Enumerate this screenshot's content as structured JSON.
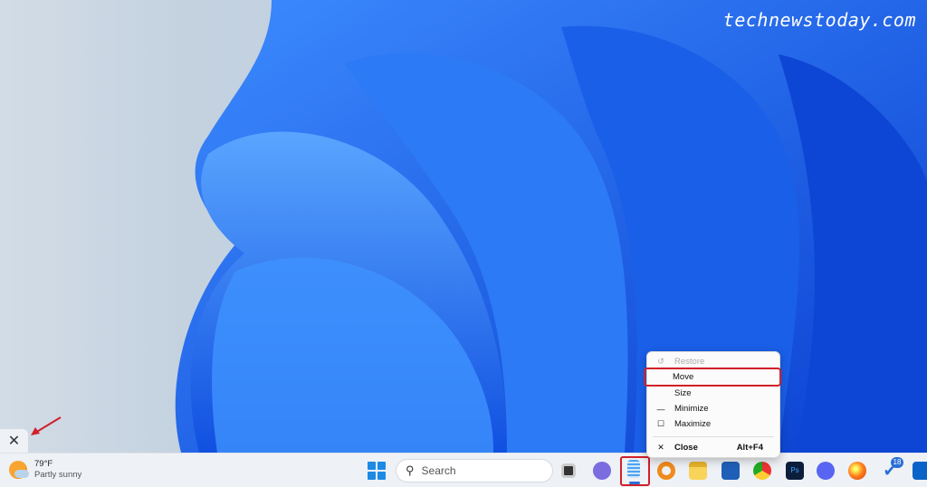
{
  "watermark": "technewstoday.com",
  "widget_close": "✕",
  "weather": {
    "temp": "79°F",
    "desc": "Partly sunny"
  },
  "taskbar": {
    "search_placeholder": "Search",
    "todo_badge": "18",
    "icons": [
      "start",
      "task-view",
      "teams",
      "notepad",
      "search-tool",
      "file-explorer",
      "store",
      "chrome",
      "photoshop",
      "discord",
      "firefox",
      "todo",
      "outlook"
    ]
  },
  "context_menu": {
    "items": [
      {
        "icon": "↺",
        "label": "Restore",
        "disabled": true
      },
      {
        "icon": "",
        "label": "Move",
        "highlighted": true
      },
      {
        "icon": "",
        "label": "Size"
      },
      {
        "icon": "—",
        "label": "Minimize"
      },
      {
        "icon": "☐",
        "label": "Maximize"
      },
      {
        "icon": "✕",
        "label": "Close",
        "shortcut": "Alt+F4"
      }
    ]
  },
  "colors": {
    "accent": "#1d6ff2",
    "highlight": "#d1202a"
  }
}
